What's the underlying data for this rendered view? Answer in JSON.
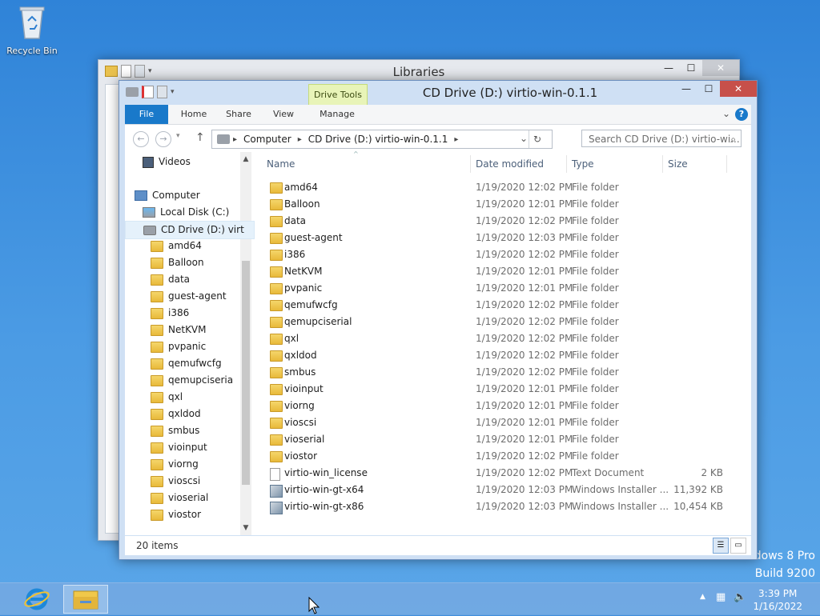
{
  "desktop": {
    "recycle_bin_label": "Recycle Bin",
    "watermark_line1": "dows 8 Pro",
    "watermark_line2": "Build 9200"
  },
  "back_window": {
    "title": "Libraries"
  },
  "window": {
    "title": "CD Drive (D:) virtio-win-0.1.1",
    "context_tab_group": "Drive Tools",
    "tabs": [
      "File",
      "Home",
      "Share",
      "View",
      "Manage"
    ],
    "help_label": "?",
    "address": {
      "segments": [
        "Computer",
        "CD Drive (D:) virtio-win-0.1.1"
      ]
    },
    "search_placeholder": "Search CD Drive (D:) virtio-wi..."
  },
  "nav_pane": {
    "items": [
      {
        "label": "Videos",
        "icon": "video-library-icon"
      },
      {
        "label": "Computer",
        "icon": "computer-icon"
      },
      {
        "label": "Local Disk (C:)",
        "icon": "local-disk-icon"
      },
      {
        "label": "CD Drive (D:) virt",
        "icon": "cd-drive-icon",
        "selected": true
      },
      {
        "label": "amd64",
        "icon": "folder-icon"
      },
      {
        "label": "Balloon",
        "icon": "folder-icon"
      },
      {
        "label": "data",
        "icon": "folder-icon"
      },
      {
        "label": "guest-agent",
        "icon": "folder-icon"
      },
      {
        "label": "i386",
        "icon": "folder-icon"
      },
      {
        "label": "NetKVM",
        "icon": "folder-icon"
      },
      {
        "label": "pvpanic",
        "icon": "folder-icon"
      },
      {
        "label": "qemufwcfg",
        "icon": "folder-icon"
      },
      {
        "label": "qemupciserial",
        "icon": "folder-icon"
      },
      {
        "label": "qxl",
        "icon": "folder-icon"
      },
      {
        "label": "qxldod",
        "icon": "folder-icon"
      },
      {
        "label": "smbus",
        "icon": "folder-icon"
      },
      {
        "label": "vioinput",
        "icon": "folder-icon"
      },
      {
        "label": "viorng",
        "icon": "folder-icon"
      },
      {
        "label": "vioscsi",
        "icon": "folder-icon"
      },
      {
        "label": "vioserial",
        "icon": "folder-icon"
      },
      {
        "label": "viostor",
        "icon": "folder-icon"
      }
    ]
  },
  "file_list": {
    "columns": [
      "Name",
      "Date modified",
      "Type",
      "Size"
    ],
    "rows": [
      {
        "name": "amd64",
        "date": "1/19/2020 12:02 PM",
        "type": "File folder",
        "size": "",
        "icon": "folder-icon"
      },
      {
        "name": "Balloon",
        "date": "1/19/2020 12:01 PM",
        "type": "File folder",
        "size": "",
        "icon": "folder-icon"
      },
      {
        "name": "data",
        "date": "1/19/2020 12:02 PM",
        "type": "File folder",
        "size": "",
        "icon": "folder-icon"
      },
      {
        "name": "guest-agent",
        "date": "1/19/2020 12:03 PM",
        "type": "File folder",
        "size": "",
        "icon": "folder-icon"
      },
      {
        "name": "i386",
        "date": "1/19/2020 12:02 PM",
        "type": "File folder",
        "size": "",
        "icon": "folder-icon"
      },
      {
        "name": "NetKVM",
        "date": "1/19/2020 12:01 PM",
        "type": "File folder",
        "size": "",
        "icon": "folder-icon"
      },
      {
        "name": "pvpanic",
        "date": "1/19/2020 12:01 PM",
        "type": "File folder",
        "size": "",
        "icon": "folder-icon"
      },
      {
        "name": "qemufwcfg",
        "date": "1/19/2020 12:02 PM",
        "type": "File folder",
        "size": "",
        "icon": "folder-icon"
      },
      {
        "name": "qemupciserial",
        "date": "1/19/2020 12:02 PM",
        "type": "File folder",
        "size": "",
        "icon": "folder-icon"
      },
      {
        "name": "qxl",
        "date": "1/19/2020 12:02 PM",
        "type": "File folder",
        "size": "",
        "icon": "folder-icon"
      },
      {
        "name": "qxldod",
        "date": "1/19/2020 12:02 PM",
        "type": "File folder",
        "size": "",
        "icon": "folder-icon"
      },
      {
        "name": "smbus",
        "date": "1/19/2020 12:02 PM",
        "type": "File folder",
        "size": "",
        "icon": "folder-icon"
      },
      {
        "name": "vioinput",
        "date": "1/19/2020 12:01 PM",
        "type": "File folder",
        "size": "",
        "icon": "folder-icon"
      },
      {
        "name": "viorng",
        "date": "1/19/2020 12:01 PM",
        "type": "File folder",
        "size": "",
        "icon": "folder-icon"
      },
      {
        "name": "vioscsi",
        "date": "1/19/2020 12:01 PM",
        "type": "File folder",
        "size": "",
        "icon": "folder-icon"
      },
      {
        "name": "vioserial",
        "date": "1/19/2020 12:01 PM",
        "type": "File folder",
        "size": "",
        "icon": "folder-icon"
      },
      {
        "name": "viostor",
        "date": "1/19/2020 12:02 PM",
        "type": "File folder",
        "size": "",
        "icon": "folder-icon"
      },
      {
        "name": "virtio-win_license",
        "date": "1/19/2020 12:02 PM",
        "type": "Text Document",
        "size": "2 KB",
        "icon": "text-document-icon"
      },
      {
        "name": "virtio-win-gt-x64",
        "date": "1/19/2020 12:03 PM",
        "type": "Windows Installer ...",
        "size": "11,392 KB",
        "icon": "installer-icon"
      },
      {
        "name": "virtio-win-gt-x86",
        "date": "1/19/2020 12:03 PM",
        "type": "Windows Installer ...",
        "size": "10,454 KB",
        "icon": "installer-icon"
      }
    ]
  },
  "status_bar": {
    "item_count": "20 items"
  },
  "taskbar": {
    "clock_time": "3:39 PM",
    "clock_date": "1/16/2022"
  }
}
